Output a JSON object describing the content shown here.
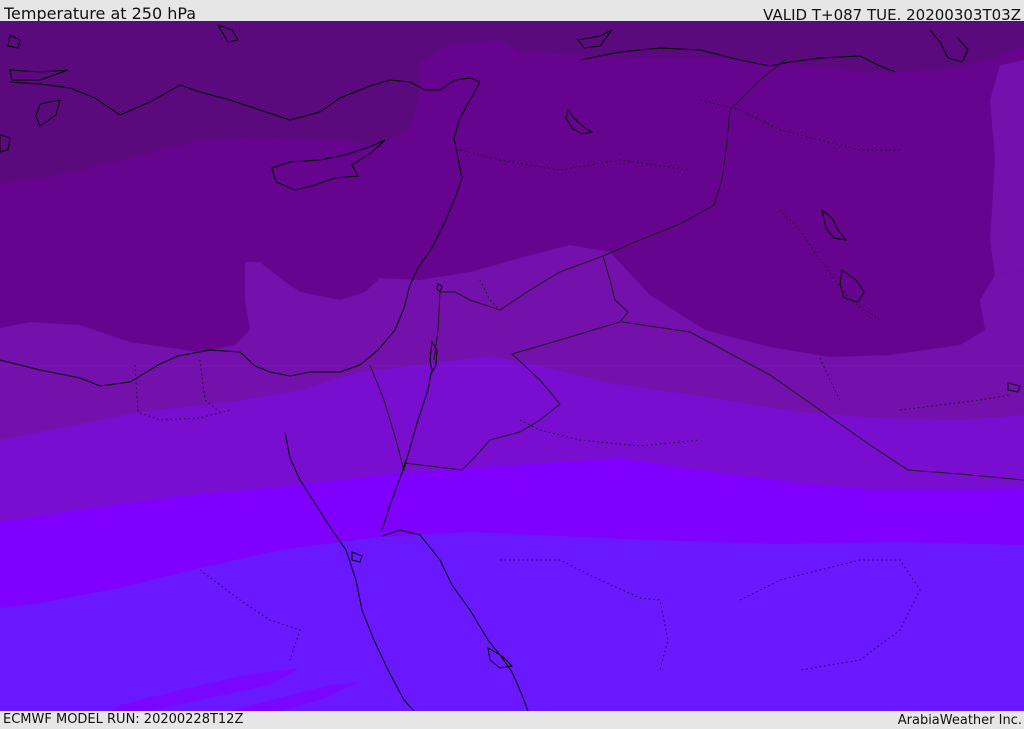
{
  "header": {
    "title": "Temperature at 250 hPa",
    "valid_time": "VALID T+087 TUE. 20200303T03Z"
  },
  "footer": {
    "model_run": "ECMWF MODEL RUN: 20200228T12Z",
    "credit": "ArabiaWeather Inc."
  },
  "map": {
    "variable": "Temperature",
    "level": "250 hPa",
    "colors": {
      "band_1": "#5b0a7e",
      "band_2": "#66038f",
      "band_3": "#7410ab",
      "band_4": "#7a0ed0",
      "band_5": "#8000ff",
      "band_6": "#6a18ff",
      "coastline": "#000000",
      "border": "#1a1a1a"
    }
  }
}
